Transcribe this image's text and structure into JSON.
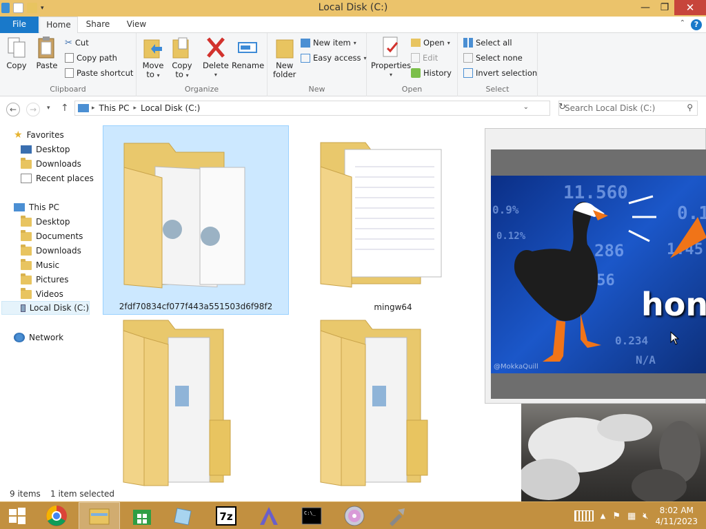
{
  "window": {
    "title": "Local Disk (C:)",
    "minimize": "—",
    "maximize": "❐",
    "close": "✕"
  },
  "tabs": {
    "file": "File",
    "home": "Home",
    "share": "Share",
    "view": "View"
  },
  "ribbon": {
    "clipboard": {
      "group": "Clipboard",
      "copy": "Copy",
      "paste": "Paste",
      "cut": "Cut",
      "copy_path": "Copy path",
      "paste_shortcut": "Paste shortcut"
    },
    "organize": {
      "group": "Organize",
      "move_to_1": "Move",
      "move_to_2": "to",
      "copy_to_1": "Copy",
      "copy_to_2": "to",
      "delete": "Delete",
      "rename": "Rename"
    },
    "new": {
      "group": "New",
      "new_folder_1": "New",
      "new_folder_2": "folder",
      "new_item": "New item",
      "easy_access": "Easy access"
    },
    "open": {
      "group": "Open",
      "properties": "Properties",
      "open": "Open",
      "edit": "Edit",
      "history": "History"
    },
    "select": {
      "group": "Select",
      "select_all": "Select all",
      "select_none": "Select none",
      "invert": "Invert selection"
    }
  },
  "address": {
    "crumbs": [
      "This PC",
      "Local Disk (C:)"
    ],
    "search_placeholder": "Search Local Disk (C:)"
  },
  "navpane": {
    "favorites": "Favorites",
    "fav_items": [
      "Desktop",
      "Downloads",
      "Recent places"
    ],
    "this_pc": "This PC",
    "pc_items": [
      "Desktop",
      "Documents",
      "Downloads",
      "Music",
      "Pictures",
      "Videos",
      "Local Disk (C:)"
    ],
    "network": "Network"
  },
  "files": [
    {
      "name": "2fdf70834cf077f443a551503d6f98f2"
    },
    {
      "name": "mingw64"
    },
    {
      "name": ""
    },
    {
      "name": ""
    }
  ],
  "status": {
    "count": "9 items",
    "selected": "1 item selected"
  },
  "meme": {
    "text": "honk",
    "credit": "@MokkaQuill",
    "numbers": [
      "11.560",
      "0.9%",
      "0.12%",
      "286",
      "156",
      "0.234",
      "N/A",
      "1.45",
      "0.1"
    ]
  },
  "clock": {
    "time": "8:02 AM",
    "date": "4/11/2023"
  },
  "colors": {
    "titlebar": "#ebc36b",
    "taskbar": "#c29040",
    "file_tab": "#1979ca",
    "selection": "#cce8ff"
  }
}
